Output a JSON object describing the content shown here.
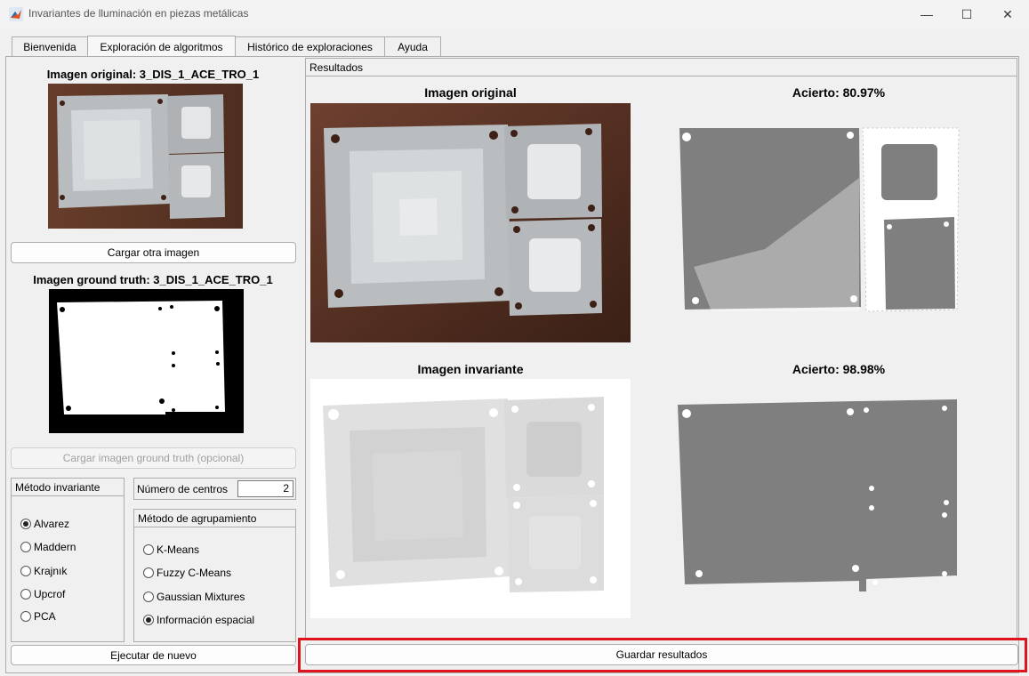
{
  "window": {
    "title": "Invariantes de lluminación en piezas metálicas",
    "app_icon": "matlab-icon",
    "controls": [
      "minimize-icon",
      "maximize-icon",
      "close-icon"
    ]
  },
  "tabs": [
    {
      "label": "Bienvenida",
      "active": false
    },
    {
      "label": "Exploración de algoritmos",
      "active": true
    },
    {
      "label": "Histórico de exploraciones",
      "active": false
    },
    {
      "label": "Ayuda",
      "active": false
    }
  ],
  "left": {
    "original_title": "Imagen original: 3_DIS_1_ACE_TRO_1",
    "load_image_button": "Cargar otra imagen",
    "ground_truth_title": "Imagen ground truth: 3_DIS_1_ACE_TRO_1",
    "load_ground_truth_button": "Cargar imagen ground truth (opcional)",
    "invariant_method": {
      "title": "Método invariante",
      "options": [
        "Alvarez",
        "Maddern",
        "Krajnık",
        "Upcrof",
        "PCA"
      ],
      "selected": "Alvarez"
    },
    "centers": {
      "label": "Número de centros",
      "value": "2"
    },
    "clustering_method": {
      "title": "Método de agrupamiento",
      "options": [
        "K-Means",
        "Fuzzy C-Means",
        "Gaussian Mixtures",
        "Información espacial"
      ],
      "selected": "Información espacial"
    },
    "run_again_button": "Ejecutar de nuevo"
  },
  "results": {
    "panel_title": "Resultados",
    "original_heading": "Imagen original",
    "original_accuracy": "Acierto: 80.97%",
    "invariant_heading": "Imagen invariante",
    "invariant_accuracy": "Acierto: 98.98%",
    "save_button": "Guardar resultados"
  },
  "colors": {
    "highlight": "#e0141e",
    "segmentation_gray": "#7f7f7f",
    "board_brown": "#5a3424"
  }
}
